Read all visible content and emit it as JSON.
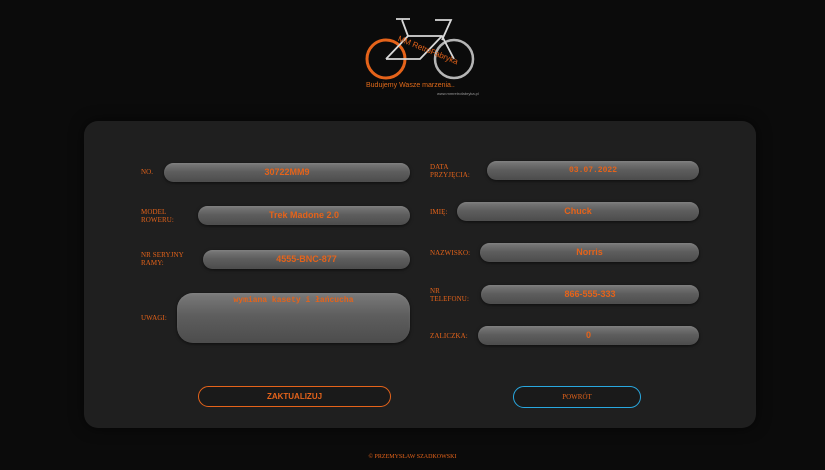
{
  "logo": {
    "mark": "MM RetroFabryka",
    "tagline": "Budujemy Wasze marzenia..",
    "url": "www.mmretrofabryka.pl"
  },
  "form": {
    "no": {
      "label": "NO.",
      "value": "30722MM9"
    },
    "model": {
      "label": "MODEL ROWERU:",
      "value": "Trek Madone 2.0"
    },
    "serial": {
      "label": "NR SERYJNY RAMY:",
      "value": "4555-BNC-877"
    },
    "notes": {
      "label": "UWAGI:",
      "value": "wymiana kasety i łańcucha"
    },
    "date": {
      "label": "DATA PRZYJĘCIA:",
      "value": "03.07.2022"
    },
    "first_name": {
      "label": "IMIĘ:",
      "value": "Chuck"
    },
    "last_name": {
      "label": "NAZWISKO:",
      "value": "Norris"
    },
    "phone": {
      "label": "NR TELEFONU:",
      "value": "866-555-333"
    },
    "deposit": {
      "label": "ZALICZKA:",
      "value": "0"
    }
  },
  "buttons": {
    "update": "ZAKTUALIZUJ",
    "back": "POWRÓT"
  },
  "footer": "© PRZEMYSŁAW SZADKOWSKI",
  "colors": {
    "accent": "#e5631a",
    "back_button_border": "#29a8e0",
    "panel": "#1f1f1f",
    "background": "#0b0b0b"
  }
}
